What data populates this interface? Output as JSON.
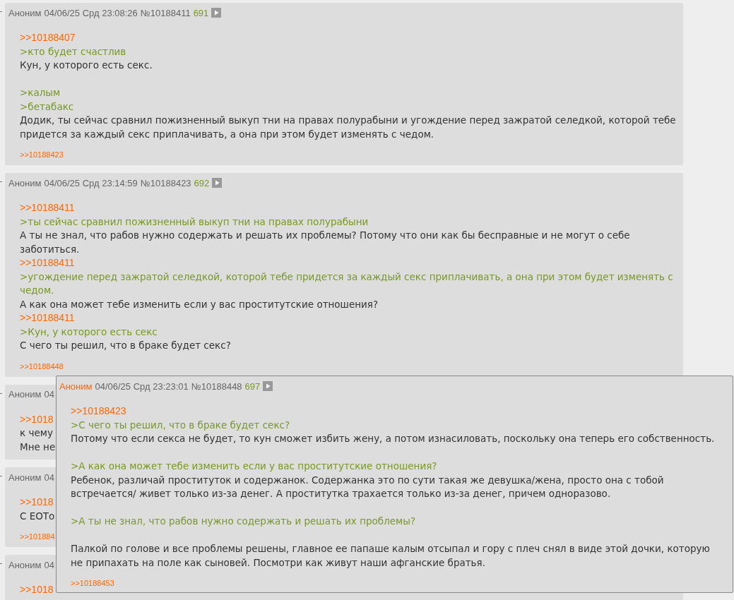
{
  "posts": [
    {
      "author": "Аноним",
      "author_highlighted": false,
      "date": "04/06/25 Срд 23:08:26",
      "number": "№10188411",
      "index": "691",
      "lines": [
        {
          "kind": "reply",
          "text": ">>10188407"
        },
        {
          "kind": "quote",
          "text": ">кто будет счастлив"
        },
        {
          "kind": "text",
          "text": "Кун, у которого есть секс."
        },
        {
          "kind": "gap"
        },
        {
          "kind": "quote",
          "text": ">калым"
        },
        {
          "kind": "quote",
          "text": ">бетабакс"
        },
        {
          "kind": "text",
          "text": "Додик, ты сейчас сравнил пожизненный выкуп тни на правах полурабыни и угождение перед зажратой селедкой, которой тебе придется за каждый секс приплачивать, а она при этом будет изменять с чедом."
        }
      ],
      "replies": [
        ">>10188423"
      ]
    },
    {
      "author": "Аноним",
      "author_highlighted": false,
      "date": "04/06/25 Срд 23:14:59",
      "number": "№10188423",
      "index": "692",
      "lines": [
        {
          "kind": "reply",
          "text": ">>10188411"
        },
        {
          "kind": "quote",
          "text": ">ты сейчас сравнил пожизненный выкуп тни на правах полурабыни"
        },
        {
          "kind": "text",
          "text": "А ты не знал, что рабов нужно содержать и решать их проблемы? Потому что они как бы бесправные и не могут о себе заботиться."
        },
        {
          "kind": "reply",
          "text": ">>10188411"
        },
        {
          "kind": "quote",
          "text": ">угождение перед зажратой селедкой, которой тебе придется за каждый секс приплачивать, а она при этом будет изменять с чедом."
        },
        {
          "kind": "text",
          "text": "А как она может тебе изменить если у вас проститутские отношения?"
        },
        {
          "kind": "reply",
          "text": ">>10188411"
        },
        {
          "kind": "quote",
          "text": ">Кун, у которого есть секс"
        },
        {
          "kind": "text",
          "text": "С чего ты решил, что в браке будет секс?"
        }
      ],
      "replies": [
        ">>10188448"
      ]
    },
    {
      "author": "Аноним",
      "author_highlighted": false,
      "date": "04",
      "lines": [
        {
          "kind": "reply",
          "text": ">>1018"
        },
        {
          "kind": "text",
          "text": "к чему"
        },
        {
          "kind": "text",
          "text": "Мне не"
        }
      ]
    },
    {
      "author": "Аноним",
      "author_highlighted": false,
      "date": "04",
      "lines": [
        {
          "kind": "reply",
          "text": ">>1018"
        },
        {
          "kind": "text",
          "text": "С ЕОТо"
        }
      ],
      "replies": [
        ">>101884"
      ]
    },
    {
      "author": "Аноним",
      "author_highlighted": false,
      "date": "04",
      "lines": [
        {
          "kind": "reply",
          "text": ">>1018"
        }
      ]
    }
  ],
  "popup": {
    "author": "Аноним",
    "author_highlighted": true,
    "date": "04/06/25 Срд 23:23:01",
    "number": "№10188448",
    "index": "697",
    "lines": [
      {
        "kind": "reply",
        "text": ">>10188423"
      },
      {
        "kind": "quote",
        "text": ">С чего ты решил, что в браке будет секс?"
      },
      {
        "kind": "text",
        "text": "Потому что если секса не будет, то кун сможет избить жену, а потом изнасиловать, поскольку она теперь его собственность."
      },
      {
        "kind": "gap"
      },
      {
        "kind": "quote",
        "text": ">А как она может тебе изменить если у вас проститутские отношения?"
      },
      {
        "kind": "text",
        "text": "Ребенок, различай проституток и содержанок. Содержанка это по сути такая же девушка/жена, просто она с тобой встречается/ живет только из-за денег. А проститутка трахается только из-за денег, причем одноразово."
      },
      {
        "kind": "gap"
      },
      {
        "kind": "quote",
        "text": ">А ты не знал, что рабов нужно содержать и решать их проблемы?"
      },
      {
        "kind": "gap"
      },
      {
        "kind": "text",
        "text": "Палкой по голове и все проблемы решены, главное ее папаше калым отсыпал и гору с плеч снял в виде этой дочки, которую не припахать на поле как сыновей. Посмотри как живут наши афганские братья."
      }
    ],
    "replies": [
      ">>10188453"
    ]
  }
}
